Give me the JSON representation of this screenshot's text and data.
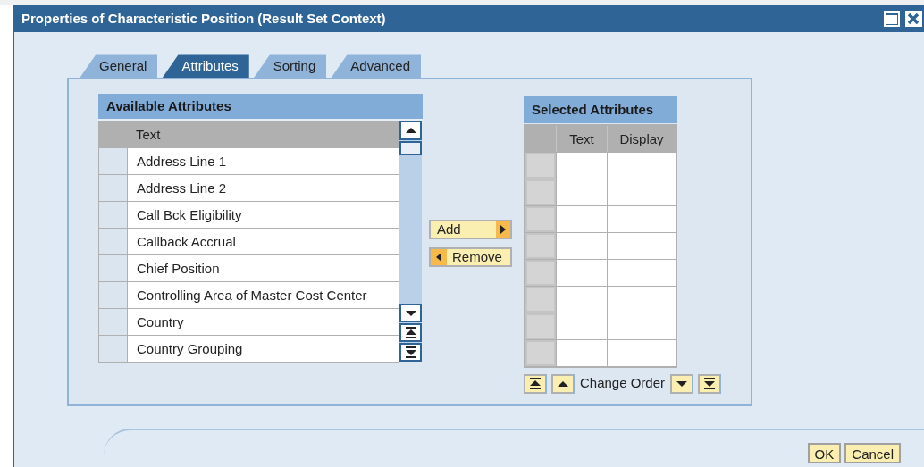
{
  "window": {
    "title": "Properties of Characteristic Position (Result Set Context)"
  },
  "tabs": [
    {
      "label": "General",
      "selected": false
    },
    {
      "label": "Attributes",
      "selected": true
    },
    {
      "label": "Sorting",
      "selected": false
    },
    {
      "label": "Advanced",
      "selected": false
    }
  ],
  "available": {
    "title": "Available Attributes",
    "column": "Text",
    "rows": [
      "Address Line 1",
      "Address Line 2",
      "Call Bck Eligibility",
      "Callback Accrual",
      "Chief Position",
      "Controlling Area of Master Cost Center",
      "Country",
      "Country Grouping"
    ]
  },
  "transfer_buttons": {
    "add": "Add",
    "remove": "Remove"
  },
  "selected": {
    "title": "Selected Attributes",
    "columns": [
      "Text",
      "Display"
    ]
  },
  "change_order": "Change Order",
  "buttons": [
    "OK",
    "Cancel"
  ]
}
